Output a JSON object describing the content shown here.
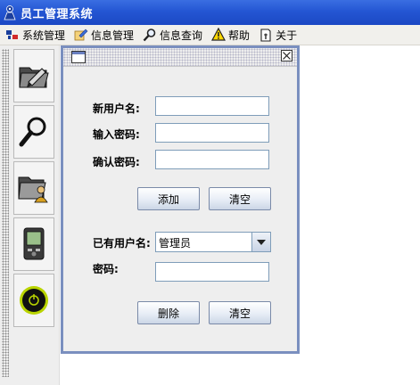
{
  "window": {
    "title": "员工管理系统"
  },
  "menu": [
    {
      "label": "系统管理",
      "icon": "system-settings-icon"
    },
    {
      "label": "信息管理",
      "icon": "info-edit-icon"
    },
    {
      "label": "信息查询",
      "icon": "search-icon"
    },
    {
      "label": "帮助",
      "icon": "warning-icon"
    },
    {
      "label": "关于",
      "icon": "about-icon"
    }
  ],
  "toolbar": [
    {
      "icon": "folder-edit-icon"
    },
    {
      "icon": "magnifier-icon"
    },
    {
      "icon": "folder-user-icon"
    },
    {
      "icon": "pda-device-icon"
    },
    {
      "icon": "power-icon"
    }
  ],
  "form": {
    "new_username_label": "新用户名:",
    "new_username_value": "",
    "password_label": "输入密码:",
    "password_value": "",
    "confirm_label": "确认密码:",
    "confirm_value": "",
    "add_button": "添加",
    "clear_button": "清空",
    "existing_user_label": "已有用户名:",
    "existing_user_selected": "管理员",
    "existing_password_label": "密码:",
    "existing_password_value": "",
    "delete_button": "删除",
    "clear_button_2": "清空"
  },
  "colors": {
    "titlebar": "#2456d3",
    "dialog_border": "#7a8fbf",
    "accent_green": "#b9d400"
  }
}
